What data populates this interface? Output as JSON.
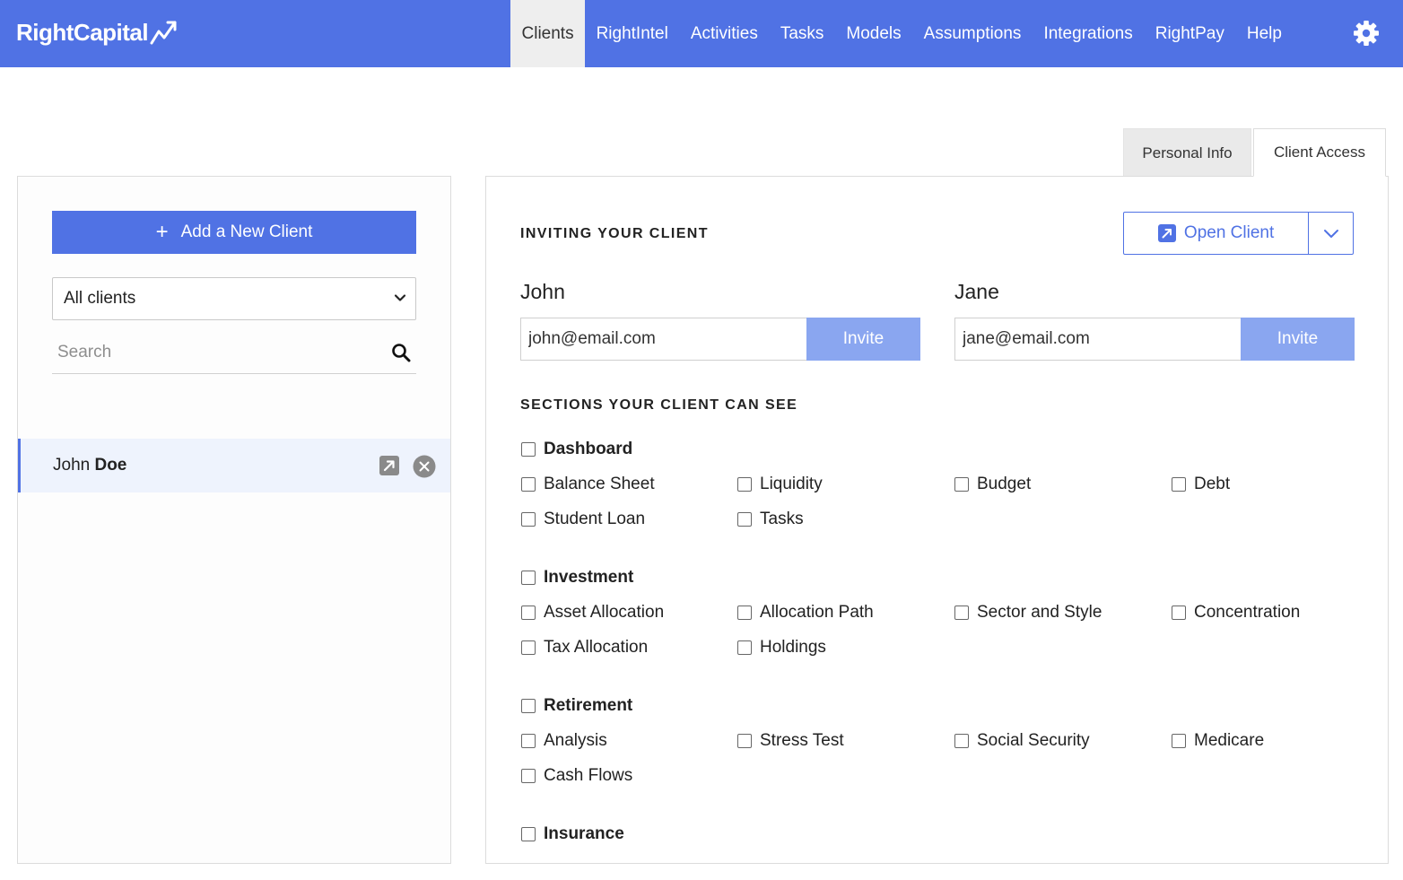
{
  "brand": {
    "name": "RightCapital"
  },
  "nav": {
    "items": [
      {
        "label": "Clients",
        "active": true
      },
      {
        "label": "RightIntel"
      },
      {
        "label": "Activities"
      },
      {
        "label": "Tasks"
      },
      {
        "label": "Models"
      },
      {
        "label": "Assumptions"
      },
      {
        "label": "Integrations"
      },
      {
        "label": "RightPay"
      },
      {
        "label": "Help"
      }
    ],
    "settings_icon": "gear-icon"
  },
  "sidebar": {
    "add_button_label": "Add a New Client",
    "filter_selected": "All clients",
    "search_placeholder": "Search",
    "clients": [
      {
        "first_name": "John",
        "last_name": "Doe"
      }
    ]
  },
  "tabs": [
    {
      "label": "Personal Info"
    },
    {
      "label": "Client Access",
      "active": true
    }
  ],
  "access": {
    "inviting_title": "INVITING YOUR CLIENT",
    "open_client_label": "Open Client",
    "people": [
      {
        "name": "John",
        "email": "john@email.com",
        "invite_label": "Invite"
      },
      {
        "name": "Jane",
        "email": "jane@email.com",
        "invite_label": "Invite"
      }
    ],
    "sections_title": "SECTIONS YOUR CLIENT CAN SEE",
    "groups": [
      {
        "title": "Dashboard",
        "items": [
          "Balance Sheet",
          "Liquidity",
          "Budget",
          "Debt",
          "Student Loan",
          "Tasks"
        ]
      },
      {
        "title": "Investment",
        "items": [
          "Asset Allocation",
          "Allocation Path",
          "Sector and Style",
          "Concentration",
          "Tax Allocation",
          "Holdings"
        ]
      },
      {
        "title": "Retirement",
        "items": [
          "Analysis",
          "Stress Test",
          "Social Security",
          "Medicare",
          "Cash Flows"
        ]
      },
      {
        "title": "Insurance",
        "items": []
      }
    ]
  },
  "colors": {
    "brand": "#5072e4",
    "invite": "#8aa6f0",
    "selected_row": "#eef3fd"
  }
}
